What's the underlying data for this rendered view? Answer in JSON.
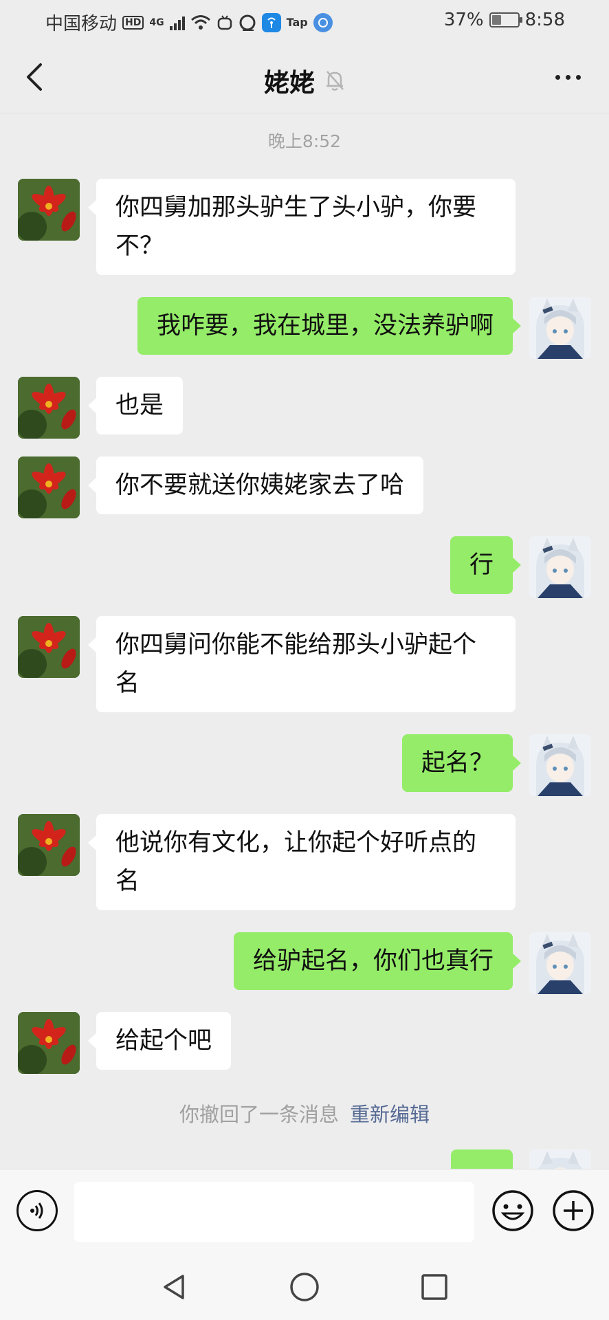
{
  "status_bar": {
    "carrier": "中国移动",
    "hd_badge": "HD",
    "network": "4G",
    "tap_label": "Tap",
    "battery_percent": "37%",
    "battery_level": 0.37,
    "time": "8:58"
  },
  "header": {
    "title": "姥姥",
    "back_icon": "chevron-left-icon",
    "mute_icon": "bell-off-icon",
    "more_icon": "more-dots-icon"
  },
  "chat": {
    "timestamp": "晚上8:52",
    "messages": [
      {
        "side": "left",
        "lines": [
          "你四舅加那头驴生了头小驴，你要",
          "不？"
        ]
      },
      {
        "side": "right",
        "lines": [
          "我咋要，我在城里，没法养驴啊"
        ]
      },
      {
        "side": "left",
        "lines": [
          "也是"
        ]
      },
      {
        "side": "left",
        "lines": [
          "你不要就送你姨姥家去了哈"
        ]
      },
      {
        "side": "right",
        "lines": [
          "行"
        ]
      },
      {
        "side": "left",
        "lines": [
          "你四舅问你能不能给那头小驴起个",
          "名"
        ]
      },
      {
        "side": "right",
        "lines": [
          "起名？"
        ]
      },
      {
        "side": "left",
        "lines": [
          "他说你有文化，让你起个好听点的",
          "名"
        ]
      },
      {
        "side": "right",
        "lines": [
          "给驴起名，你们也真行"
        ]
      },
      {
        "side": "left",
        "lines": [
          "给起个吧"
        ]
      }
    ],
    "recall_text": "你撤回了一条消息",
    "recall_edit": "重新编辑"
  },
  "input_bar": {
    "voice_icon": "voice-icon",
    "text_value": "",
    "emoji_icon": "emoji-icon",
    "plus_icon": "plus-circle-icon"
  },
  "system_nav": {
    "back": "triangle-back-icon",
    "home": "circle-home-icon",
    "recent": "square-recent-icon"
  },
  "colors": {
    "background": "#ededed",
    "my_bubble": "#95ec69",
    "their_bubble": "#ffffff",
    "link": "#576b95"
  }
}
